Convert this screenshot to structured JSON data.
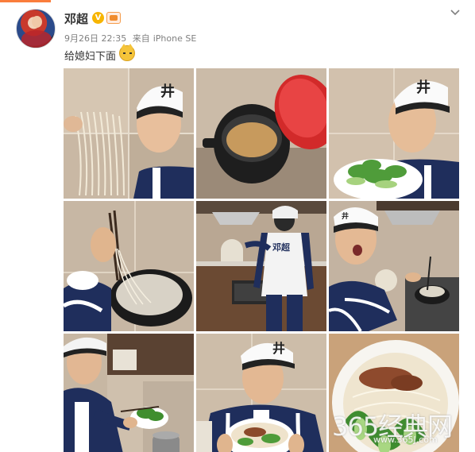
{
  "post": {
    "author": "邓超",
    "timestamp": "9月26日 22:35",
    "source_prefix": "来自",
    "device": "iPhone SE",
    "text": "给媳妇下面"
  },
  "icons": {
    "verified": "verified-v-icon",
    "member": "member-badge-icon",
    "expand": "chevron-down-icon",
    "emoji": "cat-emoji-icon"
  },
  "badge": {
    "verified_label": "V"
  },
  "photos": [
    {
      "id": "photo-noodles-face"
    },
    {
      "id": "photo-soup-pot"
    },
    {
      "id": "photo-greens-plate"
    },
    {
      "id": "photo-chopsticks-noodles"
    },
    {
      "id": "photo-cooking-back"
    },
    {
      "id": "photo-kitchen-surprised"
    },
    {
      "id": "photo-adding-greens"
    },
    {
      "id": "photo-holding-bowl"
    },
    {
      "id": "photo-noodle-bowl"
    }
  ],
  "jersey_text": "邓超",
  "hat_text": "井",
  "watermark": {
    "title": "365经典网",
    "url": "www.365J.com"
  },
  "colors": {
    "accent": "#fa7d3c",
    "verified": "#f7b500"
  }
}
